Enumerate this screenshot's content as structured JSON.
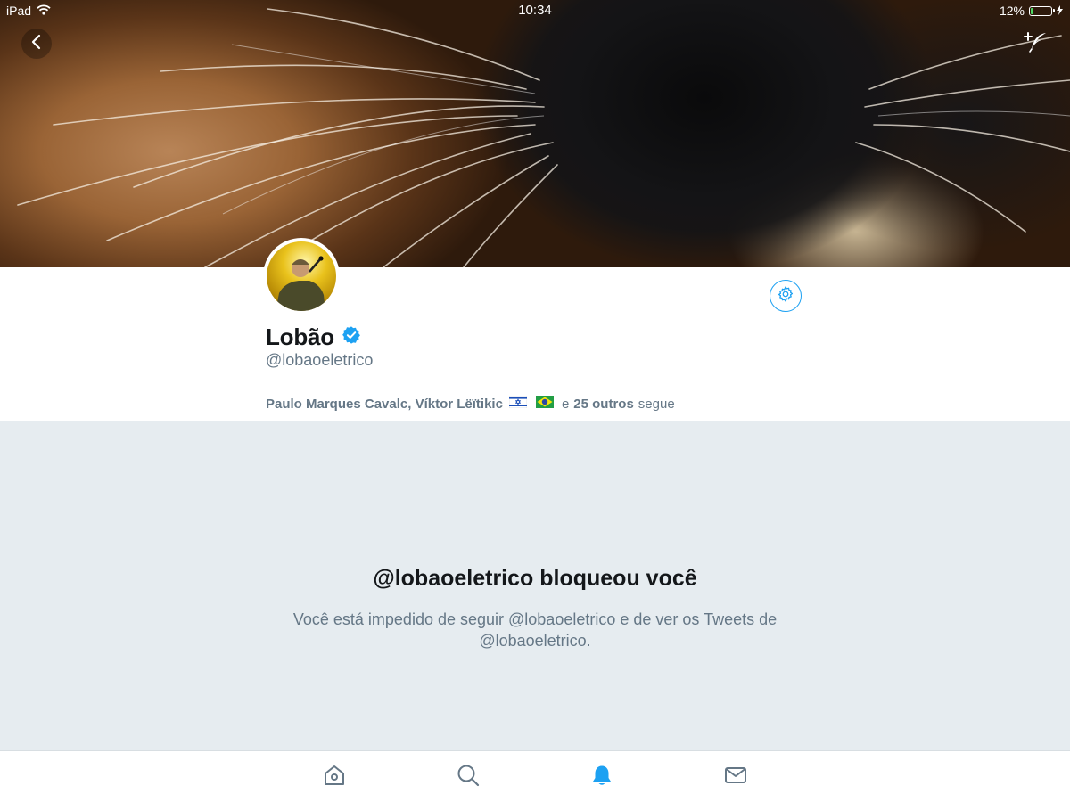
{
  "status_bar": {
    "device": "iPad",
    "time": "10:34",
    "battery_percent": "12%",
    "battery_level": 0.12,
    "battery_color": "#4cd964"
  },
  "header": {
    "back_icon": "chevron-left-icon",
    "compose_icon": "compose-quill-icon"
  },
  "profile": {
    "display_name": "Lobão",
    "verified": true,
    "handle": "@lobaoeletrico",
    "settings_icon": "gear-icon",
    "followed_by": {
      "names": "Paulo Marques Cavalc, Víktor Lëïtikic",
      "flags": [
        "israel-flag-icon",
        "brazil-flag-icon"
      ],
      "connector": "e",
      "others": "25 outros",
      "suffix": "segue"
    }
  },
  "blocked": {
    "title": "@lobaoeletrico bloqueou você",
    "description": "Você está impedido de seguir @lobaoeletrico e de ver os Tweets de @lobaoeletrico."
  },
  "tabbar": {
    "tabs": [
      {
        "icon": "home-icon",
        "active": false
      },
      {
        "icon": "search-icon",
        "active": false
      },
      {
        "icon": "notifications-bell-icon",
        "active": true
      },
      {
        "icon": "messages-envelope-icon",
        "active": false
      }
    ]
  },
  "colors": {
    "accent": "#1da1f2",
    "text_primary": "#14171a",
    "text_secondary": "#657786",
    "background": "#e6ecf0"
  }
}
